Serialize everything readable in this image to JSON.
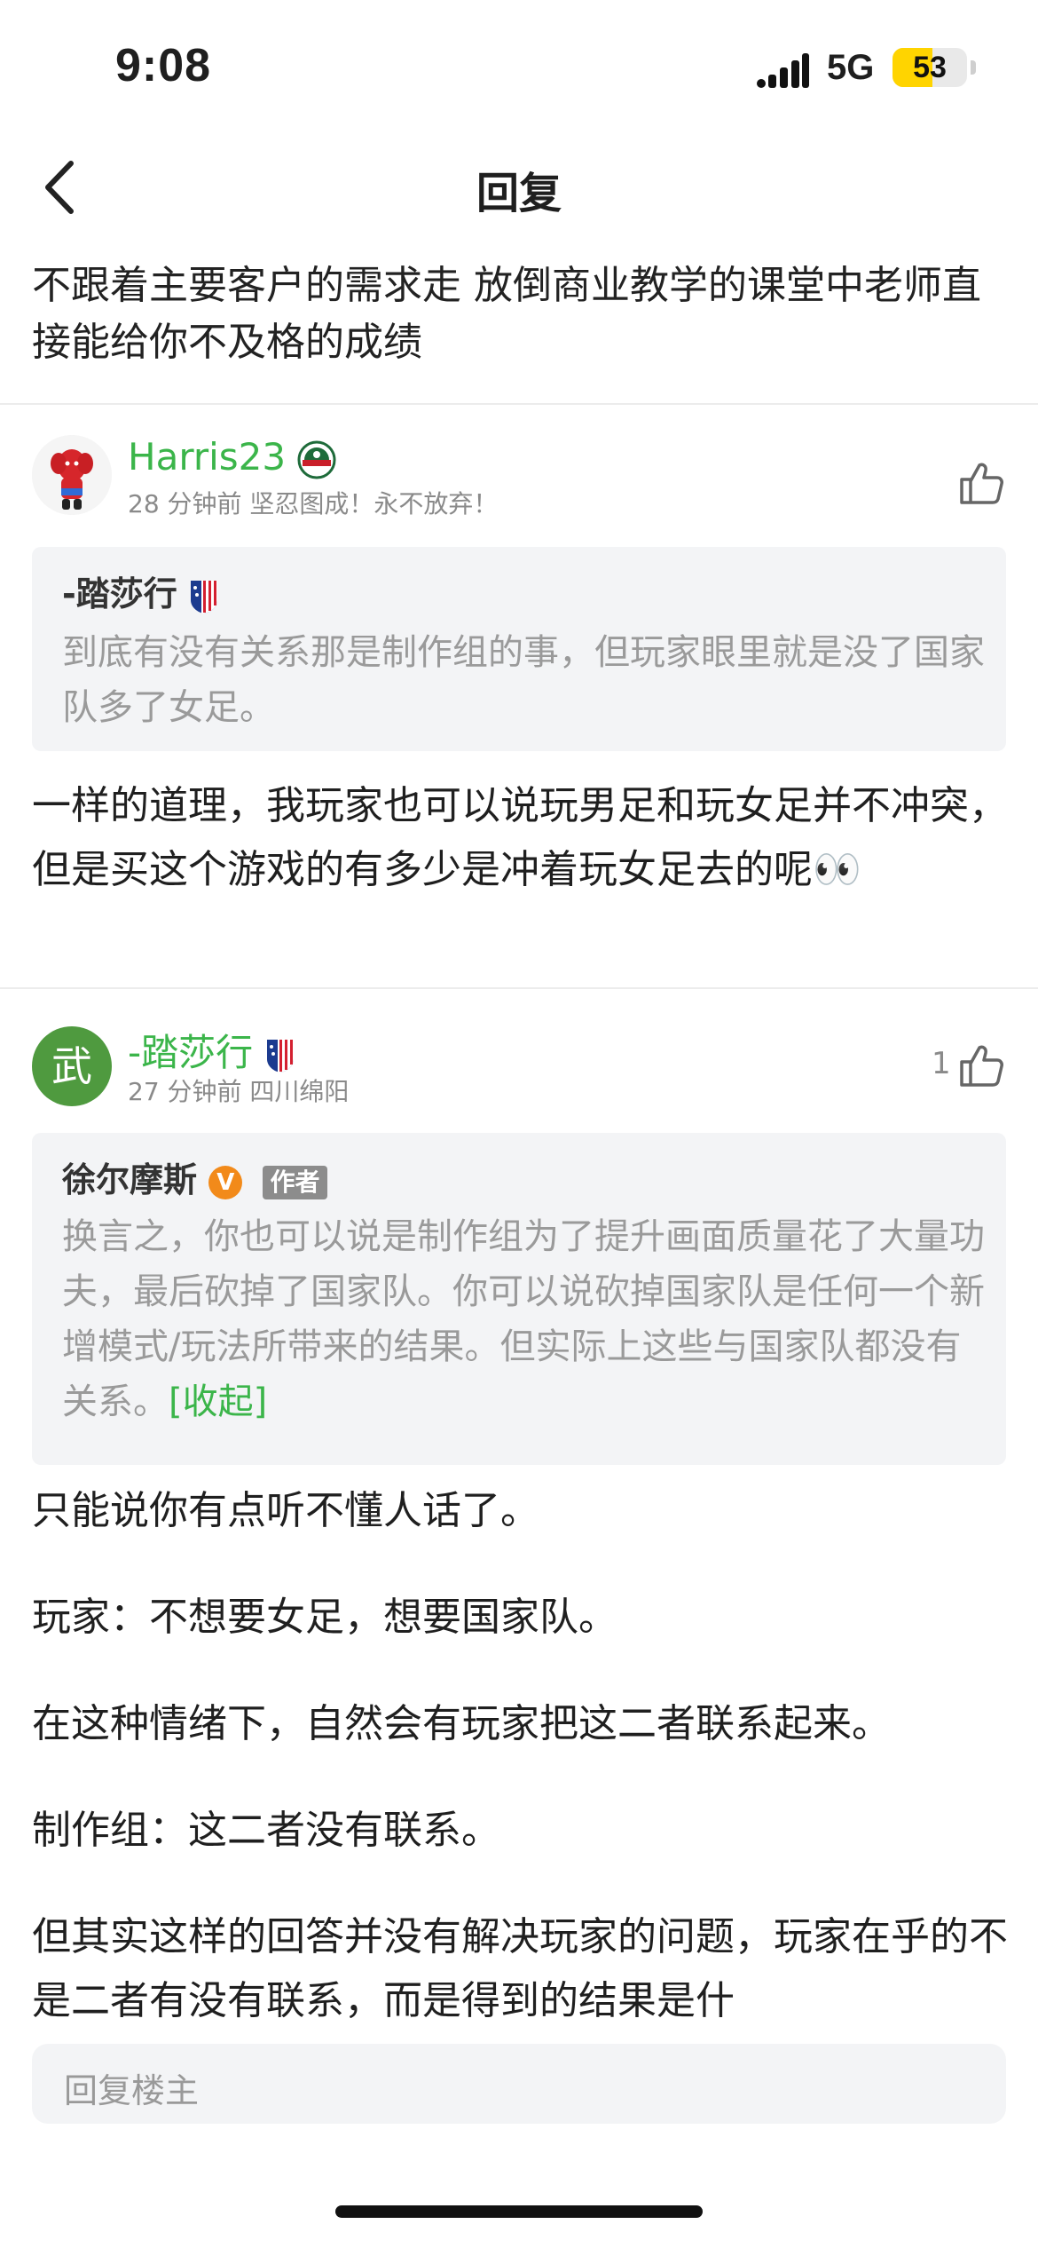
{
  "status": {
    "time": "9:08",
    "network": "5G",
    "battery": "53",
    "battery_level": 0.53
  },
  "nav": {
    "title": "回复"
  },
  "topic": {
    "text": "不跟着主要客户的需求走 放倒商业教学的课堂中老师直接能给你不及格的成绩"
  },
  "comments": [
    {
      "user": "Harris23",
      "meta": "28 分钟前 坚忍图成！永不放弃！",
      "likes": "",
      "quote": {
        "user": "-踏莎行",
        "text": "到底有没有关系那是制作组的事，但玩家眼里就是没了国家队多了女足。"
      },
      "text": "一样的道理，我玩家也可以说玩男足和玩女足并不冲突，但是买这个游戏的有多少是冲着玩女足去的呢👀"
    },
    {
      "user": "-踏莎行",
      "avatar_char": "武",
      "meta": "27 分钟前 四川绵阳",
      "likes": "1",
      "quote": {
        "user": "徐尔摩斯",
        "badge_v": "V",
        "badge_author": "作者",
        "text": "换言之，你也可以说是制作组为了提升画面质量花了大量功夫，最后砍掉了国家队。你可以说砍掉国家队是任何一个新增模式/玩法所带来的结果。但实际上这些与国家队都没有关系。",
        "collapse": "[收起]"
      },
      "paragraphs": [
        "只能说你有点听不懂人话了。",
        "玩家：不想要女足，想要国家队。",
        "在这种情绪下，自然会有玩家把这二者联系起来。",
        "制作组：这二者没有联系。",
        "但其实这样的回答并没有解决玩家的问题，玩家在乎的不是二者有没有联系，而是得到的结果是什"
      ]
    }
  ],
  "reply": {
    "placeholder": "回复楼主"
  }
}
